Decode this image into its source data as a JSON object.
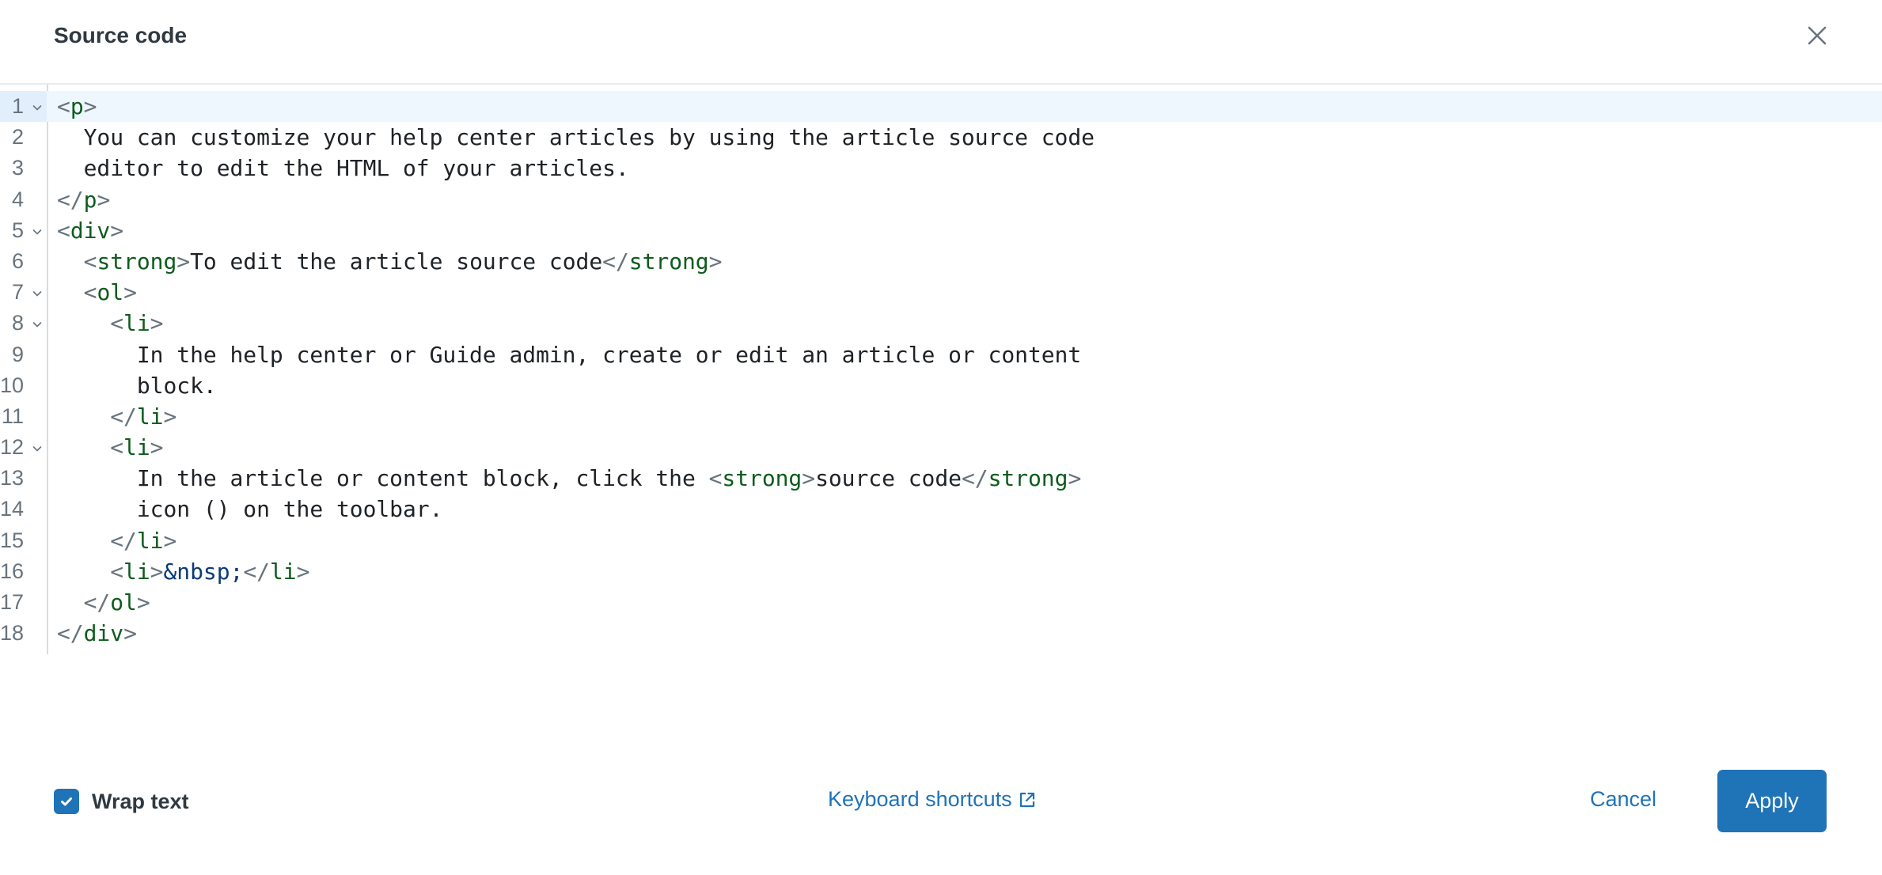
{
  "dialog": {
    "title": "Source code",
    "close_icon": "close-icon"
  },
  "editor": {
    "active_line": 1,
    "lines": [
      {
        "n": "1",
        "fold": true,
        "tokens": [
          {
            "t": "punc",
            "v": "<"
          },
          {
            "t": "tag",
            "v": "p"
          },
          {
            "t": "punc",
            "v": ">"
          }
        ]
      },
      {
        "n": "2",
        "fold": false,
        "tokens": [
          {
            "t": "txt",
            "v": "  You can customize your help center articles by using the article source code"
          }
        ]
      },
      {
        "n": "3",
        "fold": false,
        "tokens": [
          {
            "t": "txt",
            "v": "  editor to edit the HTML of your articles."
          }
        ]
      },
      {
        "n": "4",
        "fold": false,
        "tokens": [
          {
            "t": "punc",
            "v": "</"
          },
          {
            "t": "tag",
            "v": "p"
          },
          {
            "t": "punc",
            "v": ">"
          }
        ]
      },
      {
        "n": "5",
        "fold": true,
        "tokens": [
          {
            "t": "punc",
            "v": "<"
          },
          {
            "t": "tag",
            "v": "div"
          },
          {
            "t": "punc",
            "v": ">"
          }
        ]
      },
      {
        "n": "6",
        "fold": false,
        "tokens": [
          {
            "t": "txt",
            "v": "  "
          },
          {
            "t": "punc",
            "v": "<"
          },
          {
            "t": "tag",
            "v": "strong"
          },
          {
            "t": "punc",
            "v": ">"
          },
          {
            "t": "txt",
            "v": "To edit the article source code"
          },
          {
            "t": "punc",
            "v": "</"
          },
          {
            "t": "tag",
            "v": "strong"
          },
          {
            "t": "punc",
            "v": ">"
          }
        ]
      },
      {
        "n": "7",
        "fold": true,
        "tokens": [
          {
            "t": "txt",
            "v": "  "
          },
          {
            "t": "punc",
            "v": "<"
          },
          {
            "t": "tag",
            "v": "ol"
          },
          {
            "t": "punc",
            "v": ">"
          }
        ]
      },
      {
        "n": "8",
        "fold": true,
        "tokens": [
          {
            "t": "txt",
            "v": "    "
          },
          {
            "t": "punc",
            "v": "<"
          },
          {
            "t": "tag",
            "v": "li"
          },
          {
            "t": "punc",
            "v": ">"
          }
        ]
      },
      {
        "n": "9",
        "fold": false,
        "tokens": [
          {
            "t": "txt",
            "v": "      In the help center or Guide admin, create or edit an article or content"
          }
        ]
      },
      {
        "n": "10",
        "fold": false,
        "tokens": [
          {
            "t": "txt",
            "v": "      block."
          }
        ]
      },
      {
        "n": "11",
        "fold": false,
        "tokens": [
          {
            "t": "txt",
            "v": "    "
          },
          {
            "t": "punc",
            "v": "</"
          },
          {
            "t": "tag",
            "v": "li"
          },
          {
            "t": "punc",
            "v": ">"
          }
        ]
      },
      {
        "n": "12",
        "fold": true,
        "tokens": [
          {
            "t": "txt",
            "v": "    "
          },
          {
            "t": "punc",
            "v": "<"
          },
          {
            "t": "tag",
            "v": "li"
          },
          {
            "t": "punc",
            "v": ">"
          }
        ]
      },
      {
        "n": "13",
        "fold": false,
        "tokens": [
          {
            "t": "txt",
            "v": "      In the article or content block, click the "
          },
          {
            "t": "punc",
            "v": "<"
          },
          {
            "t": "tag",
            "v": "strong"
          },
          {
            "t": "punc",
            "v": ">"
          },
          {
            "t": "txt",
            "v": "source code"
          },
          {
            "t": "punc",
            "v": "</"
          },
          {
            "t": "tag",
            "v": "strong"
          },
          {
            "t": "punc",
            "v": ">"
          }
        ]
      },
      {
        "n": "14",
        "fold": false,
        "tokens": [
          {
            "t": "txt",
            "v": "      icon () on the toolbar."
          }
        ]
      },
      {
        "n": "15",
        "fold": false,
        "tokens": [
          {
            "t": "txt",
            "v": "    "
          },
          {
            "t": "punc",
            "v": "</"
          },
          {
            "t": "tag",
            "v": "li"
          },
          {
            "t": "punc",
            "v": ">"
          }
        ]
      },
      {
        "n": "16",
        "fold": false,
        "tokens": [
          {
            "t": "txt",
            "v": "    "
          },
          {
            "t": "punc",
            "v": "<"
          },
          {
            "t": "tag",
            "v": "li"
          },
          {
            "t": "punc",
            "v": ">"
          },
          {
            "t": "ent",
            "v": "&nbsp;"
          },
          {
            "t": "punc",
            "v": "</"
          },
          {
            "t": "tag",
            "v": "li"
          },
          {
            "t": "punc",
            "v": ">"
          }
        ]
      },
      {
        "n": "17",
        "fold": false,
        "tokens": [
          {
            "t": "txt",
            "v": "  "
          },
          {
            "t": "punc",
            "v": "</"
          },
          {
            "t": "tag",
            "v": "ol"
          },
          {
            "t": "punc",
            "v": ">"
          }
        ]
      },
      {
        "n": "18",
        "fold": false,
        "tokens": [
          {
            "t": "punc",
            "v": "</"
          },
          {
            "t": "tag",
            "v": "div"
          },
          {
            "t": "punc",
            "v": ">"
          }
        ]
      }
    ]
  },
  "footer": {
    "wrap_text": {
      "label": "Wrap text",
      "checked": true,
      "icon": "checkmark-icon"
    },
    "keyboard_shortcuts": {
      "label": "Keyboard shortcuts",
      "icon": "external-link-icon"
    },
    "cancel_label": "Cancel",
    "apply_label": "Apply"
  },
  "colors": {
    "accent": "#1f73b7",
    "tag": "#0d5c1c",
    "punctuation": "#68737d",
    "entity": "#0b3b75",
    "text": "#1e2226",
    "active_line_bg": "#eff7fe"
  }
}
